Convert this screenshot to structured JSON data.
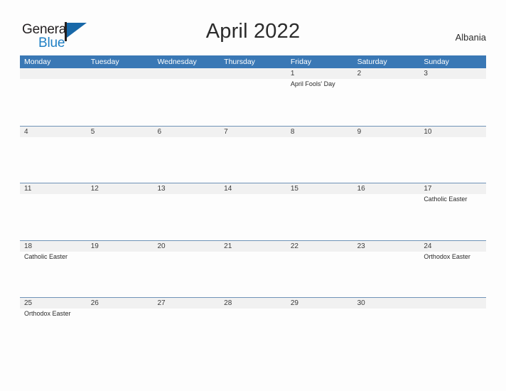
{
  "brand": {
    "name_part1": "General",
    "name_part2": "Blue",
    "flag_icon": "flag-triangle-icon",
    "accent_color": "#1f7fc4"
  },
  "header": {
    "title": "April 2022",
    "country": "Albania"
  },
  "theme": {
    "header_blue": "#3a78b5",
    "band_gray": "#f1f1f1",
    "rule_color": "#6f93b7",
    "text_color": "#2b2b2b"
  },
  "calendar": {
    "weekdays": [
      "Monday",
      "Tuesday",
      "Wednesday",
      "Thursday",
      "Friday",
      "Saturday",
      "Sunday"
    ],
    "weeks": [
      [
        {
          "num": "",
          "event": ""
        },
        {
          "num": "",
          "event": ""
        },
        {
          "num": "",
          "event": ""
        },
        {
          "num": "",
          "event": ""
        },
        {
          "num": "1",
          "event": "April Fools' Day"
        },
        {
          "num": "2",
          "event": ""
        },
        {
          "num": "3",
          "event": ""
        }
      ],
      [
        {
          "num": "4",
          "event": ""
        },
        {
          "num": "5",
          "event": ""
        },
        {
          "num": "6",
          "event": ""
        },
        {
          "num": "7",
          "event": ""
        },
        {
          "num": "8",
          "event": ""
        },
        {
          "num": "9",
          "event": ""
        },
        {
          "num": "10",
          "event": ""
        }
      ],
      [
        {
          "num": "11",
          "event": ""
        },
        {
          "num": "12",
          "event": ""
        },
        {
          "num": "13",
          "event": ""
        },
        {
          "num": "14",
          "event": ""
        },
        {
          "num": "15",
          "event": ""
        },
        {
          "num": "16",
          "event": ""
        },
        {
          "num": "17",
          "event": "Catholic Easter"
        }
      ],
      [
        {
          "num": "18",
          "event": "Catholic Easter"
        },
        {
          "num": "19",
          "event": ""
        },
        {
          "num": "20",
          "event": ""
        },
        {
          "num": "21",
          "event": ""
        },
        {
          "num": "22",
          "event": ""
        },
        {
          "num": "23",
          "event": ""
        },
        {
          "num": "24",
          "event": "Orthodox Easter"
        }
      ],
      [
        {
          "num": "25",
          "event": "Orthodox Easter"
        },
        {
          "num": "26",
          "event": ""
        },
        {
          "num": "27",
          "event": ""
        },
        {
          "num": "28",
          "event": ""
        },
        {
          "num": "29",
          "event": ""
        },
        {
          "num": "30",
          "event": ""
        },
        {
          "num": "",
          "event": ""
        }
      ]
    ]
  }
}
